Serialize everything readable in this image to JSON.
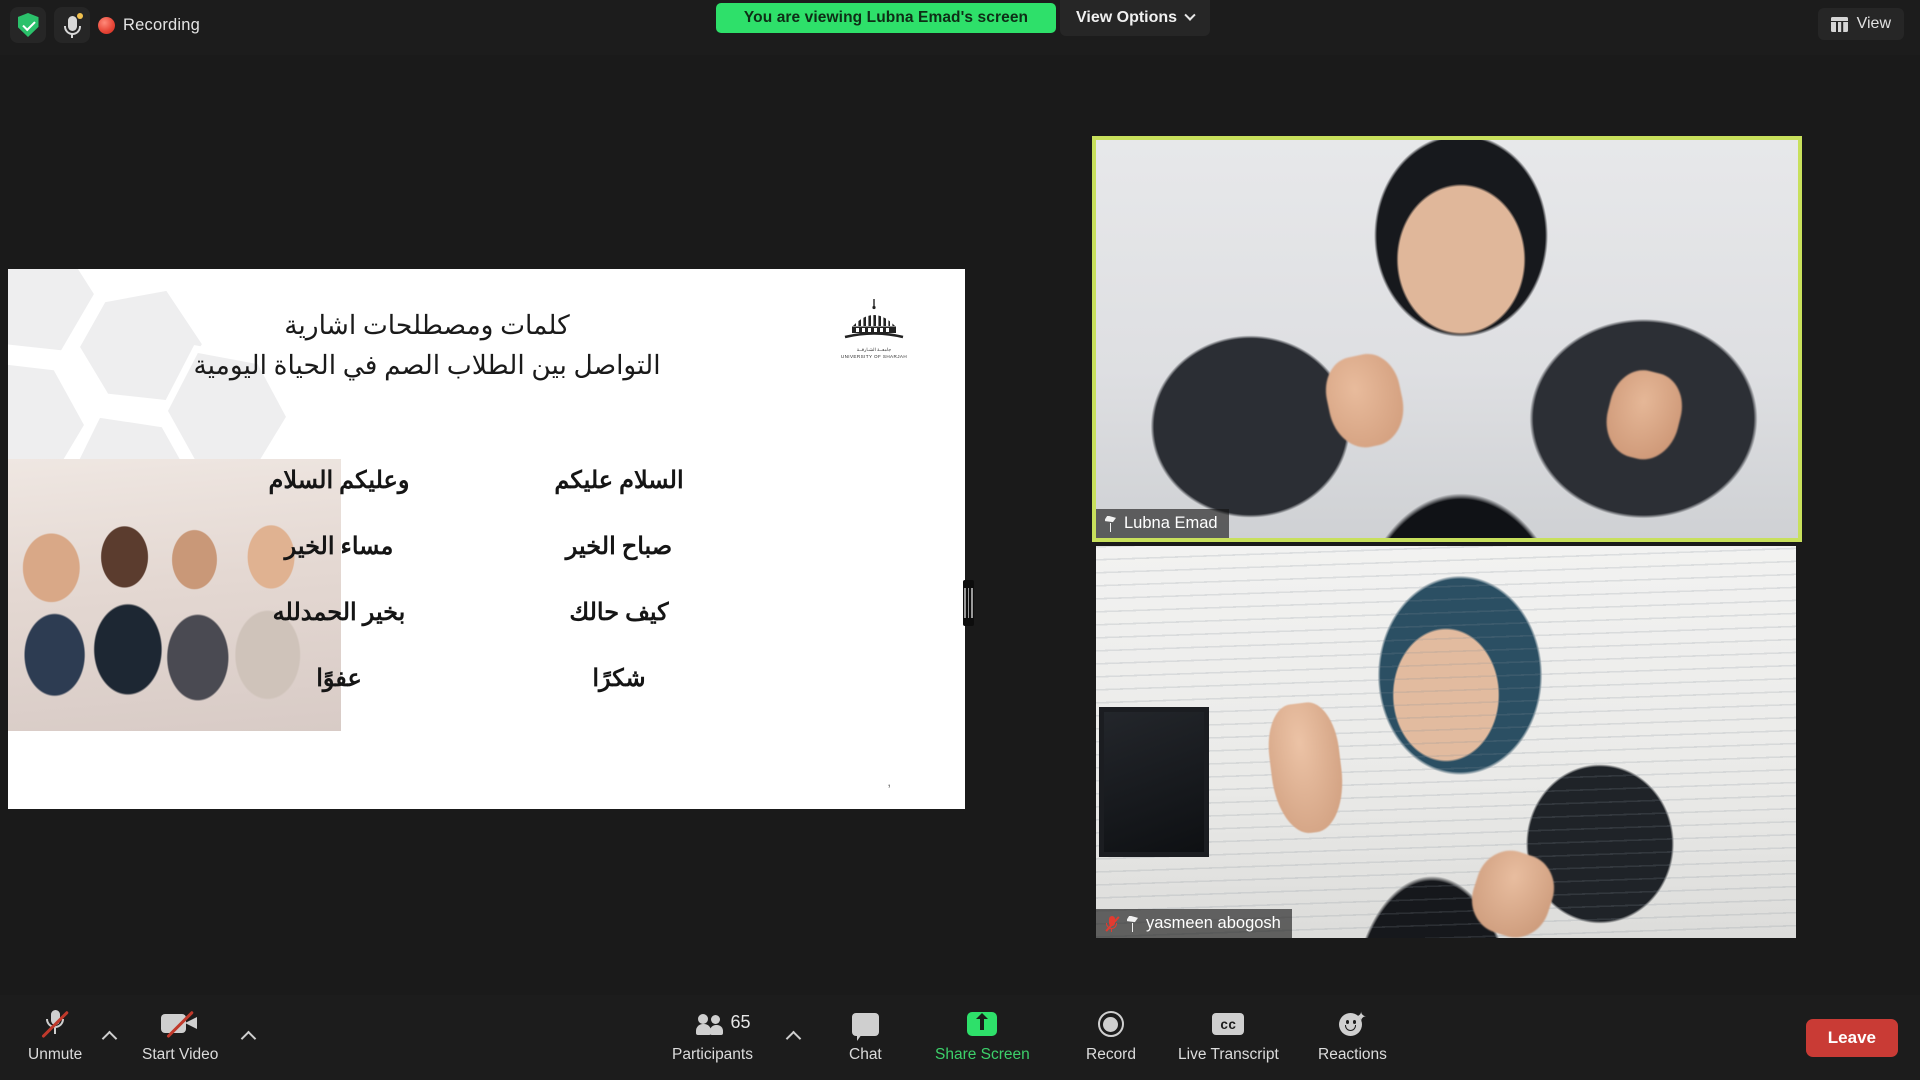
{
  "topbar": {
    "shield_icon": "shield-check-icon",
    "mic_icon": "mic-status-icon",
    "recording_icon": "record-dot-icon",
    "recording_label": "Recording",
    "share_banner": "You are viewing Lubna Emad's screen",
    "view_options_label": "View Options",
    "view_options_caret": "chevron-down-icon",
    "view_button_label": "View",
    "view_button_icon": "grid-view-icon"
  },
  "slide": {
    "title_line1": "كلمات ومصطلحات اشارية",
    "title_line2": "التواصل بين الطلاب الصم في الحياة اليومية",
    "logo_name": "university-of-sharjah-logo",
    "logo_caption_ar": "جامعــة الشـارقــة",
    "logo_caption_en": "UNIVERSITY OF SHARJAH",
    "photo_alt": "group-of-students-photo",
    "pattern_alt": "islamic-geometric-pattern-watermark",
    "page_mark": ",",
    "phrases": [
      {
        "prompt": "السلام عليكم",
        "reply": "وعليكم السلام"
      },
      {
        "prompt": "صباح الخير",
        "reply": "مساء الخير"
      },
      {
        "prompt": "كيف حالك",
        "reply": "بخير الحمدلله"
      },
      {
        "prompt": "شكرًا",
        "reply": "عفوًا"
      }
    ]
  },
  "videos": [
    {
      "name": "Lubna Emad",
      "pinned": true,
      "muted": false,
      "active_speaker": true,
      "border_color": "#c8e05c"
    },
    {
      "name": "yasmeen abogosh",
      "pinned": true,
      "muted": true,
      "active_speaker": false,
      "border_color": "transparent"
    }
  ],
  "toolbar": {
    "audio_label": "Unmute",
    "audio_icon": "mic-muted-icon",
    "video_label": "Start Video",
    "video_icon": "camera-off-icon",
    "participants_label": "Participants",
    "participants_icon": "people-icon",
    "participants_count": "65",
    "chat_label": "Chat",
    "chat_icon": "chat-bubble-icon",
    "share_label": "Share Screen",
    "share_icon": "share-screen-up-arrow-icon",
    "record_label": "Record",
    "record_icon": "record-circle-icon",
    "transcript_label": "Live Transcript",
    "transcript_icon": "closed-caption-icon",
    "reactions_label": "Reactions",
    "reactions_icon": "smiley-reaction-icon",
    "leave_label": "Leave",
    "caret_icon": "chevron-up-icon",
    "share_accent": "#3cd06a",
    "leave_color": "#c93b35"
  }
}
